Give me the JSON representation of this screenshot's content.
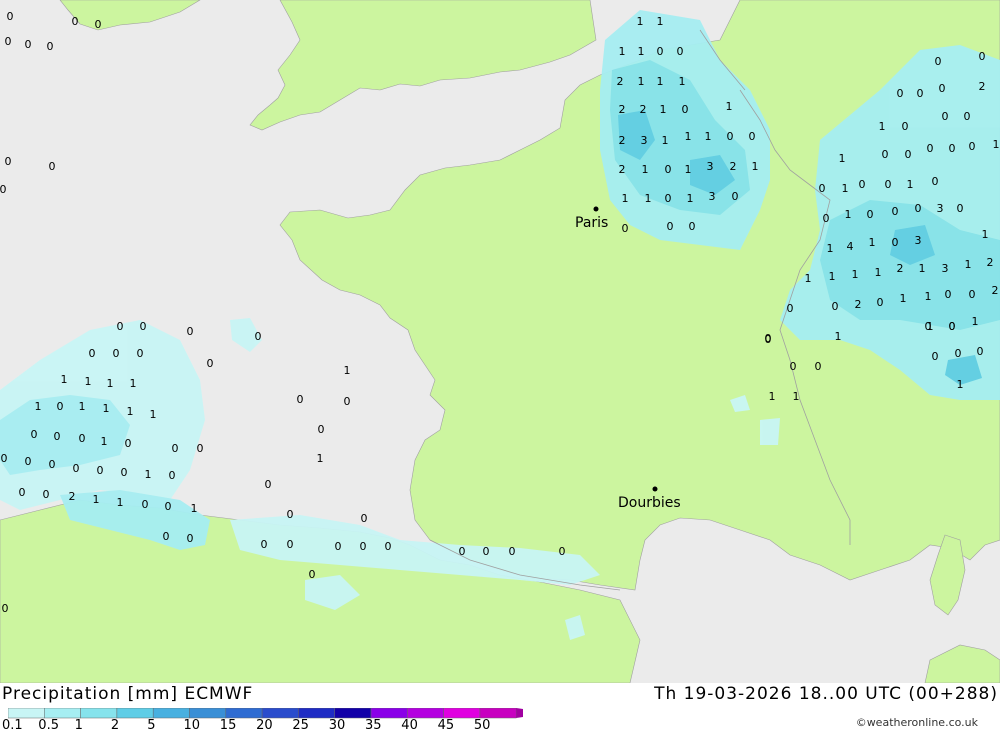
{
  "title": {
    "product": "Precipitation [mm] ECMWF",
    "valid_time": "Th 19-03-2026 18..00 UTC (00+288)"
  },
  "credit": "©weatheronline.co.uk",
  "cities": [
    {
      "name": "Paris"
    },
    {
      "name": "Dourbies"
    }
  ],
  "scale": {
    "labels": [
      "0.1",
      "0.5",
      "1",
      "2",
      "5",
      "10",
      "15",
      "20",
      "25",
      "30",
      "35",
      "40",
      "45",
      "50"
    ],
    "colors": [
      "#c8f5f5",
      "#a6eef2",
      "#86e3ec",
      "#5fcde6",
      "#48b0e0",
      "#3a8fd6",
      "#2f6cd2",
      "#2a4ccc",
      "#1f2cc4",
      "#1200a8",
      "#8a00e8",
      "#b400e0",
      "#e000e0",
      "#c800c0",
      "#a000a0"
    ]
  },
  "colors": {
    "sea": "#ebebeb",
    "land": "#ccf59f",
    "border": "#a0a0a0",
    "precip_light": "#c8f5f5",
    "precip_mid": "#a6eef2",
    "precip_high": "#86e3ec",
    "precip_peak": "#5fcde6"
  },
  "values": {
    "north_sea": [
      "1",
      "1",
      "1",
      "1",
      "0",
      "0",
      "2",
      "1",
      "1",
      "1",
      "2",
      "2",
      "1",
      "0",
      "1",
      "2",
      "3",
      "1",
      "1",
      "1",
      "0",
      "0",
      "2",
      "1",
      "0",
      "1",
      "3",
      "2",
      "1",
      "1",
      "1",
      "0",
      "1",
      "3",
      "0",
      "0",
      "0",
      "0"
    ],
    "east": [
      "0",
      "0",
      "0",
      "0",
      "0",
      "2",
      "1",
      "0",
      "0",
      "0",
      "1",
      "0",
      "0",
      "0",
      "0",
      "0",
      "1",
      "0",
      "0",
      "1",
      "0",
      "0",
      "1",
      "0",
      "1",
      "0",
      "0",
      "0",
      "3",
      "0",
      "1",
      "4",
      "1",
      "0",
      "3",
      "1",
      "1",
      "1",
      "1",
      "1",
      "2",
      "1",
      "3",
      "1",
      "2",
      "0",
      "2",
      "0",
      "1",
      "1",
      "0",
      "0",
      "2",
      "0",
      "1",
      "1",
      "0",
      "1",
      "0",
      "0",
      "0",
      "0"
    ],
    "biscay": [
      "0",
      "0",
      "0",
      "0",
      "0",
      "0",
      "0",
      "0",
      "1",
      "0",
      "0",
      "0",
      "1",
      "1",
      "1",
      "1",
      "1",
      "1",
      "0",
      "1",
      "1",
      "1",
      "1",
      "0",
      "0",
      "0",
      "1",
      "0",
      "0",
      "0",
      "0",
      "0",
      "0",
      "0",
      "0",
      "0",
      "1",
      "0",
      "0",
      "0",
      "2",
      "1",
      "1",
      "0",
      "0",
      "1",
      "0",
      "0",
      "0"
    ],
    "atlantic": [
      "0",
      "0",
      "0",
      "0",
      "0",
      "0",
      "0",
      "0",
      "0",
      "0",
      "0",
      "0",
      "0",
      "0",
      "0",
      "0",
      "0",
      "0"
    ],
    "south": [
      "0",
      "0",
      "0",
      "0",
      "1",
      "1",
      "0",
      "0",
      "0",
      "0",
      "0",
      "0",
      "1"
    ]
  }
}
